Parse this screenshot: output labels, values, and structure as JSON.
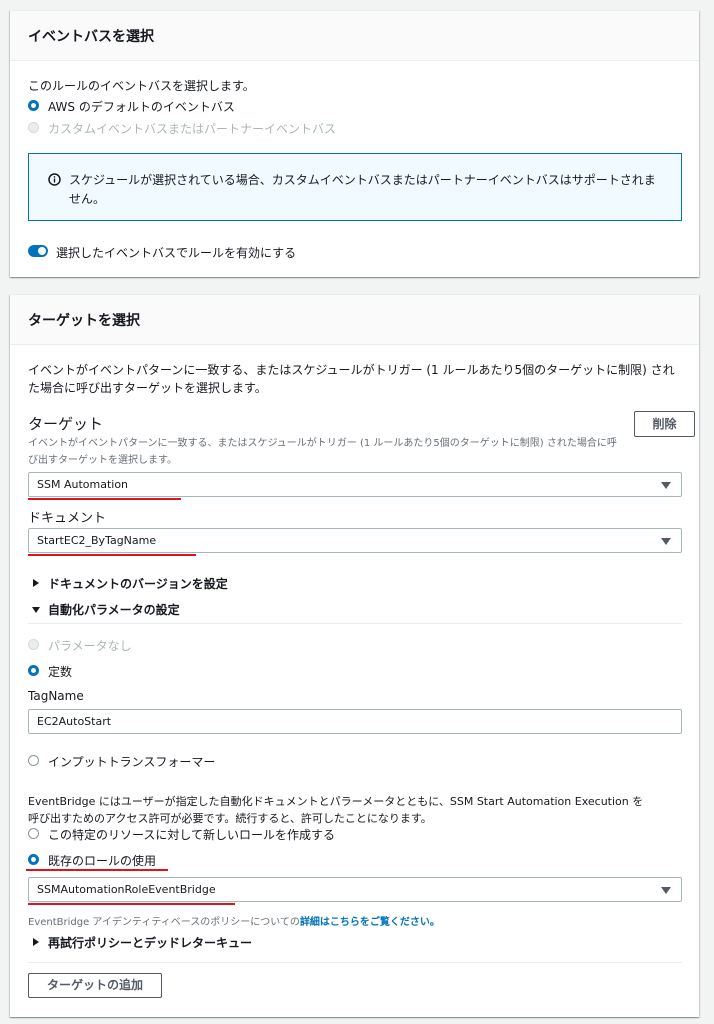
{
  "event_bus": {
    "title": "イベントバスを選択",
    "desc": "このルールのイベントバスを選択します。",
    "option_default": "AWS のデフォルトのイベントバス",
    "option_custom": "カスタムイベントバスまたはパートナーイベントバス",
    "info_line1": "スケジュールが選択されている場合、カスタムイベントバスまたはパートナーイベントバスはサポートされま",
    "info_line2": "せん。",
    "toggle_label": "選択したイベントバスでルールを有効にする"
  },
  "targets": {
    "title": "ターゲットを選択",
    "desc_line1": "イベントがイベントパターンに一致する、またはスケジュールがトリガー (1 ルールあたり5個のターゲットに制限) され",
    "desc_line2": "た場合に呼び出すターゲットを選択します。",
    "target_label": "ターゲット",
    "target_desc_line1": "イベントがイベントパターンに一致する、またはスケジュールがトリガー (1 ルールあたり5個のターゲットに制限) された場合に呼",
    "target_desc_line2": "び出すターゲットを選択します。",
    "remove_button": "削除",
    "target_select_value": "SSM Automation",
    "document_label": "ドキュメント",
    "document_select_value": "StartEC2_ByTagName",
    "doc_version_expander": "ドキュメントのバージョンを設定",
    "automation_params_expander": "自動化パラメータの設定",
    "param_none": "パラメータなし",
    "param_constant": "定数",
    "tagname_label": "TagName",
    "tagname_value": "EC2AutoStart",
    "param_input_transformer": "インプットトランスフォーマー",
    "permission_line1": "EventBridge にはユーザーが指定した自動化ドキュメントとパラーメータとともに、SSM Start Automation Execution を",
    "permission_line2": "呼び出すためのアクセス許可が必要です。続行すると、許可したことになります。",
    "role_create_new": "この特定のリソースに対して新しいロールを作成する",
    "role_use_existing": "既存のロールの使用",
    "role_select_value": "SSMAutomationRoleEventBridge",
    "policy_note_prefix": "EventBridge アイデンティティベースのポリシーについての",
    "policy_note_link": "詳細はこちらをご覧ください。",
    "retry_expander": "再試行ポリシーとデッドレターキュー",
    "add_target_button": "ターゲットの追加"
  },
  "colors": {
    "accent": "#0073bb",
    "annotation_red": "#e0131b"
  }
}
